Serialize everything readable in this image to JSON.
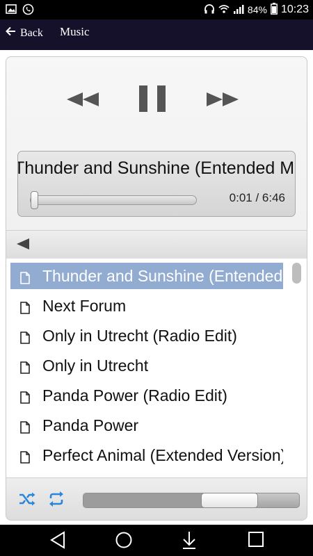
{
  "status_bar": {
    "battery": "84%",
    "time": "10:23",
    "icons": [
      "image-icon",
      "whatsapp-icon",
      "headphones-icon",
      "wifi-icon",
      "signal-icon",
      "battery-icon"
    ]
  },
  "app_bar": {
    "back_label": "Back",
    "title": "Music"
  },
  "player": {
    "controls": [
      "rewind-icon",
      "pause-icon",
      "fast-forward-icon"
    ],
    "now_playing": "Thunder and Sunshine (Entended Mix)",
    "elapsed": "0:01",
    "duration": "6:46",
    "time_display": "0:01 / 6:46",
    "seek_fraction": 0.0025
  },
  "playlist": {
    "items": [
      {
        "title": "Thunder and Sunshine (Entended Mix)",
        "active": true
      },
      {
        "title": "Next Forum",
        "active": false
      },
      {
        "title": "Only in Utrecht (Radio Edit)",
        "active": false
      },
      {
        "title": "Only in Utrecht",
        "active": false
      },
      {
        "title": "Panda Power (Radio Edit)",
        "active": false
      },
      {
        "title": "Panda Power",
        "active": false
      },
      {
        "title": "Perfect Animal (Extended Version)",
        "active": false
      }
    ]
  },
  "bottom_controls": {
    "shuffle_icon": "shuffle-icon",
    "repeat_icon": "repeat-icon",
    "volume_fraction": 0.74
  },
  "colors": {
    "app_bar": "#15112b",
    "active_row": "#92acd1",
    "accent_icons": "#2a86d8"
  },
  "system_nav": [
    "back-triangle-icon",
    "home-circle-icon",
    "download-icon",
    "recents-square-icon"
  ]
}
